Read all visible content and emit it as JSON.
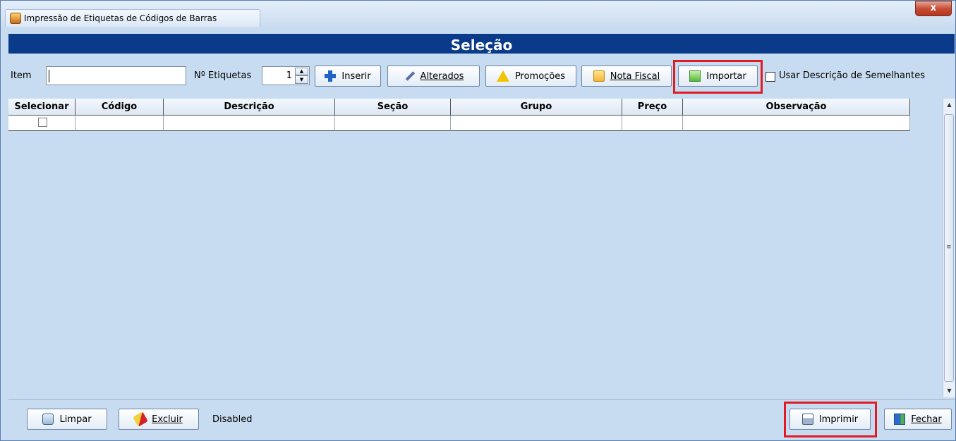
{
  "window": {
    "title": "Impressão de Etiquetas de Códigos de Barras",
    "close_label": "x"
  },
  "header": {
    "title": "Seleção"
  },
  "toolbar": {
    "item_label": "Item",
    "item_value": "",
    "etiquetas_label": "Nº Etiquetas",
    "etiquetas_value": "1",
    "inserir_label": "Inserir",
    "alterados_label": "Alterados",
    "promocoes_label": "Promoções",
    "nota_fiscal_label": "Nota Fiscal",
    "importar_label": "Importar",
    "usar_descricao_label": "Usar Descrição de Semelhantes",
    "usar_descricao_checked": false
  },
  "table": {
    "columns": [
      "Selecionar",
      "Código",
      "Descrição",
      "Seção",
      "Grupo",
      "Preço",
      "Observação"
    ],
    "rows": [
      {
        "selected": false,
        "codigo": "",
        "descricao": "",
        "secao": "",
        "grupo": "",
        "preco": "",
        "observacao": ""
      }
    ]
  },
  "footer": {
    "limpar_label": "Limpar",
    "excluir_label": "Excluir",
    "status_text": "Disabled",
    "imprimir_label": "Imprimir",
    "fechar_label": "Fechar"
  },
  "colors": {
    "header_bar": "#0a3a8a",
    "highlight": "#e01b24",
    "background": "#c8dcf1"
  }
}
